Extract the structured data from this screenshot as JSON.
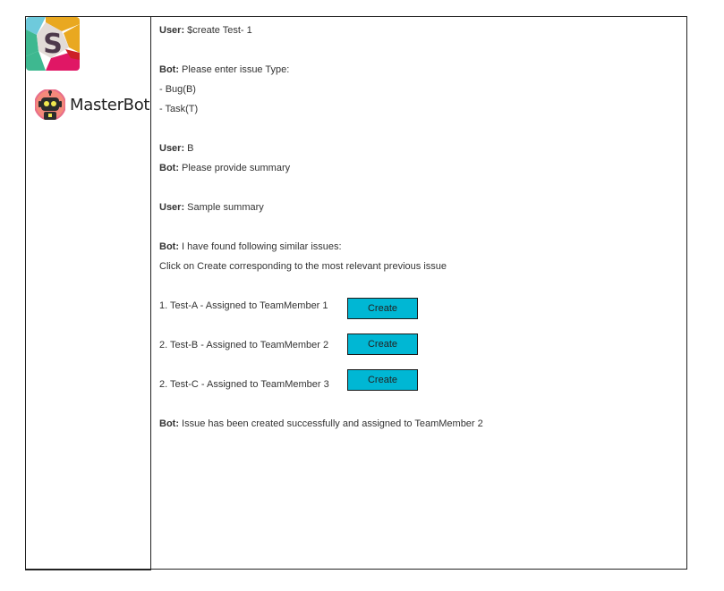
{
  "sidebar": {
    "bot_name": "MasterBot"
  },
  "chat": {
    "m1_speaker": "User:",
    "m1_text": " $create Test- 1",
    "m2_speaker": "Bot:",
    "m2_text": " Please enter issue Type:",
    "m2_opt1": "- Bug(B)",
    "m2_opt2": "- Task(T)",
    "m3_speaker": "User:",
    "m3_text": " B",
    "m4_speaker": "Bot:",
    "m4_text": " Please provide summary",
    "m5_speaker": "User:",
    "m5_text": " Sample summary",
    "m6_speaker": "Bot:",
    "m6_text": " I have found following similar issues:",
    "m6_sub": "Click on Create corresponding to the most relevant previous issue",
    "issues": [
      {
        "label": "1. Test-A - Assigned to TeamMember 1",
        "button": "Create"
      },
      {
        "label": "2. Test-B - Assigned to TeamMember 2",
        "button": "Create"
      },
      {
        "label": "2. Test-C - Assigned to TeamMember 3",
        "button": "Create"
      }
    ],
    "m7_speaker": "Bot:",
    "m7_text": " Issue has been created successfully and assigned to TeamMember 2"
  },
  "colors": {
    "button_bg": "#00b7d4",
    "border": "#222222"
  }
}
